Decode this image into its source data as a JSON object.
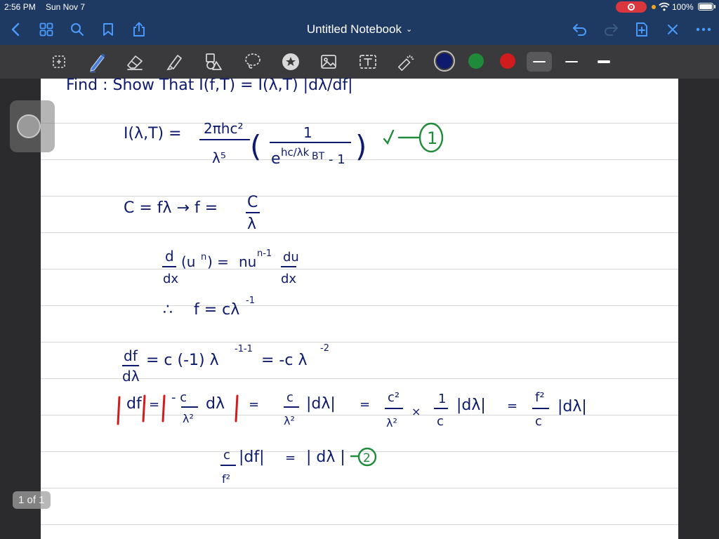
{
  "status_bar": {
    "time": "2:56 PM",
    "date": "Sun Nov 7",
    "battery": "100%"
  },
  "nav": {
    "title": "Untitled Notebook",
    "icons": [
      "back-icon",
      "grid-icon",
      "search-icon",
      "bookmark-icon",
      "share-icon",
      "undo-icon",
      "redo-icon",
      "add-page-icon",
      "close-icon",
      "more-icon"
    ]
  },
  "toolbar": {
    "tools": [
      "lasso-select-icon",
      "pen-icon",
      "eraser-icon",
      "highlighter-icon",
      "shapes-icon",
      "lasso-icon",
      "sticker-icon",
      "image-icon",
      "text-icon",
      "laser-pointer-icon"
    ],
    "colors": [
      "#0d1a6e",
      "#1f8a3a",
      "#d01c1c"
    ],
    "selected_color": "#0d1a6e",
    "strokes": [
      "thin",
      "medium",
      "thick"
    ],
    "selected_stroke": "thin"
  },
  "page_indicator": "1 of 1",
  "ink": {
    "line0": "Find : Show That     I(f,T) = I(λ,T) |dλ/df|",
    "i_lambda": "I(λ,T) =",
    "num_2phc2": "2πhc²",
    "den_l5": "λ⁵",
    "paren_open": "(",
    "one": "1",
    "exp_denom": "e",
    "exp_sup": "hc/λk",
    "exp_sub": "BT",
    "minus_one": "- 1",
    "paren_close": ")",
    "check": "√",
    "circle_1": "1",
    "c_eq_fl": "C = fλ  →  f =",
    "c_over": "C",
    "lambda_under": "λ",
    "d_dx": "d",
    "dx": "dx",
    "un": "(u",
    "un_sup": "n",
    "un_close": ") =",
    "nu": "nu",
    "nu_sup": "n-1",
    "du": "du",
    "dx2": "dx",
    "therefore": "∴",
    "f_eq_cl": "f = cλ",
    "f_eq_sup": "-1",
    "df": "df",
    "dl": "dλ",
    "deriv_rhs": "= c (-1) λ",
    "deriv_sup": "-1-1",
    "deriv_rhs2": "= -c λ",
    "deriv_sup2": "-2",
    "abs_df": "df",
    "eq1": "=",
    "neg_c": "- c",
    "l2": "λ²",
    "dl_abs": "dλ",
    "eq2": "=",
    "c_num": "c",
    "l2b": "λ²",
    "abs_dl": "|dλ|",
    "eq3": "=",
    "c2": "c²",
    "l2c": "λ²",
    "times": "×",
    "one2": "1",
    "c_den": "c",
    "abs_dl2": "|dλ|",
    "eq4": "=",
    "f2": "f²",
    "c_den2": "c",
    "abs_dl3": "|dλ|",
    "c_frac": "c",
    "f2_den": "f²",
    "abs_df2": "|df|",
    "eq5": "=",
    "abs_dl4": "| dλ |",
    "circle_2": "2"
  }
}
